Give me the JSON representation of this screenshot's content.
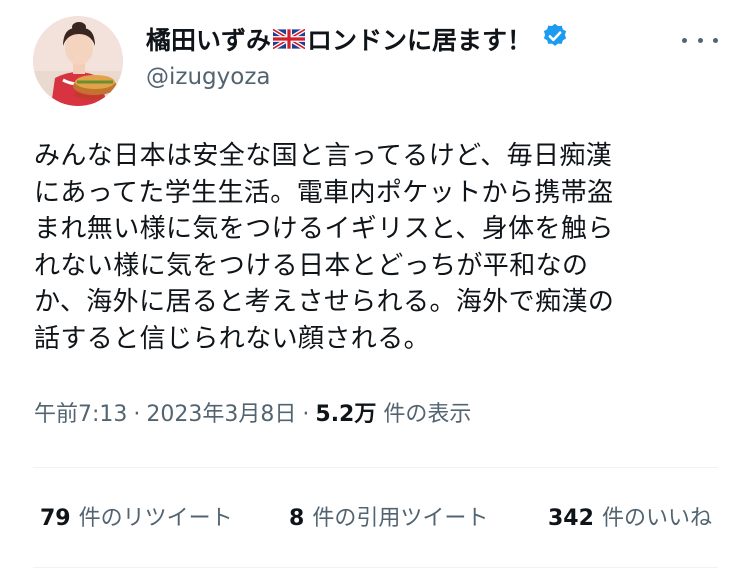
{
  "author": {
    "display_name_before_flag": "橘田いずみ",
    "display_name_after_flag": "ロンドンに居ます！",
    "flag_icon": "uk-flag-icon",
    "verified_icon": "verified-badge-icon",
    "handle": "@izugyoza"
  },
  "tweet": {
    "lines": [
      "みんな日本は安全な国と言ってるけど、毎日痴漢",
      "にあってた学生生活。電車内ポケットから携帯盗",
      "まれ無い様に気をつけるイギリスと、身体を触ら",
      "れない様に気をつける日本とどっちが平和なの",
      "か、海外に居ると考えさせられる。海外で痴漢の",
      "話すると信じられない顔される。"
    ]
  },
  "meta": {
    "time": "午前7:13",
    "separator": "·",
    "date": "2023年3月8日",
    "views_count": "5.2万",
    "views_label": "件の表示"
  },
  "stats": {
    "retweets_count": "79",
    "retweets_label": "件のリツイート",
    "quotes_count": "8",
    "quotes_label": "件の引用ツイート",
    "likes_count": "342",
    "likes_label": "件のいいね"
  },
  "colors": {
    "text": "#0f1419",
    "secondary": "#536471",
    "verified": "#1d9bf0",
    "divider": "#eff3f4"
  }
}
